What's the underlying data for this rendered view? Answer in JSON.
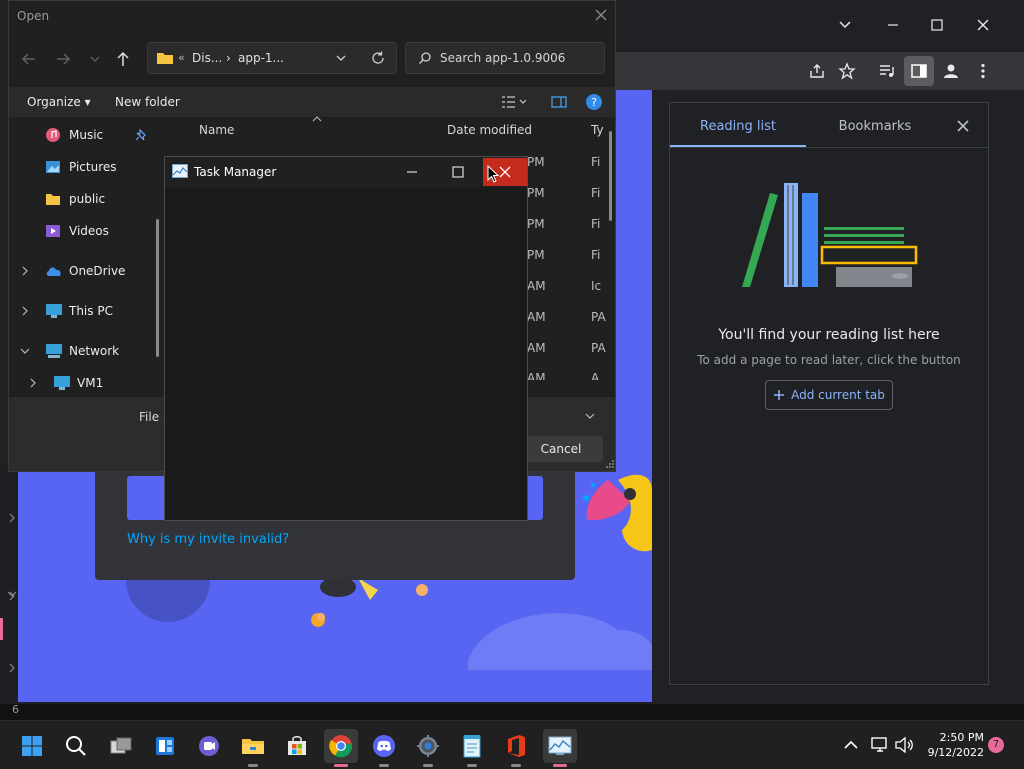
{
  "open_dialog": {
    "title": "Open",
    "breadcrumb": [
      "Dis...",
      "app-1..."
    ],
    "search_placeholder": "Search app-1.0.9006",
    "organize_label": "Organize",
    "new_folder_label": "New folder",
    "nav_items": [
      {
        "label": "Music",
        "icon": "music-icon",
        "pinned": true
      },
      {
        "label": "Pictures",
        "icon": "pictures-icon"
      },
      {
        "label": "public",
        "icon": "folder-icon"
      },
      {
        "label": "Videos",
        "icon": "videos-icon"
      },
      {
        "label": "OneDrive",
        "icon": "cloud-icon"
      },
      {
        "label": "This PC",
        "icon": "pc-icon"
      },
      {
        "label": "Network",
        "icon": "network-icon",
        "expanded": true
      },
      {
        "label": "VM1",
        "icon": "pc-icon"
      }
    ],
    "columns": {
      "name": "Name",
      "date_modified": "Date modified",
      "type": "Ty"
    },
    "row_time_fragments": [
      "PM",
      "PM",
      "PM",
      "PM",
      "AM",
      "AM",
      "AM",
      "AM"
    ],
    "row_type_fragments": [
      "Fi",
      "Fi",
      "Fi",
      "Fi",
      "Ic",
      "PA",
      "PA",
      "A"
    ],
    "file_name_label": "File n",
    "cancel_label": "Cancel",
    "status_fragment": "6"
  },
  "task_manager": {
    "title": "Task Manager"
  },
  "discord": {
    "invite_link": "Why is my invite invalid?"
  },
  "reading_panel": {
    "tab_reading": "Reading list",
    "tab_bookmarks": "Bookmarks",
    "heading": "You'll find your reading list here",
    "subtext": "To add a page to read later, click the button",
    "add_button": "Add current tab"
  },
  "taskbar": {
    "time": "2:50 PM",
    "date": "9/12/2022",
    "notification_count": "7"
  },
  "colors": {
    "accent_blue": "#8ab4f8",
    "discord_blurple": "#5865f2",
    "close_red": "#c42b1c"
  }
}
